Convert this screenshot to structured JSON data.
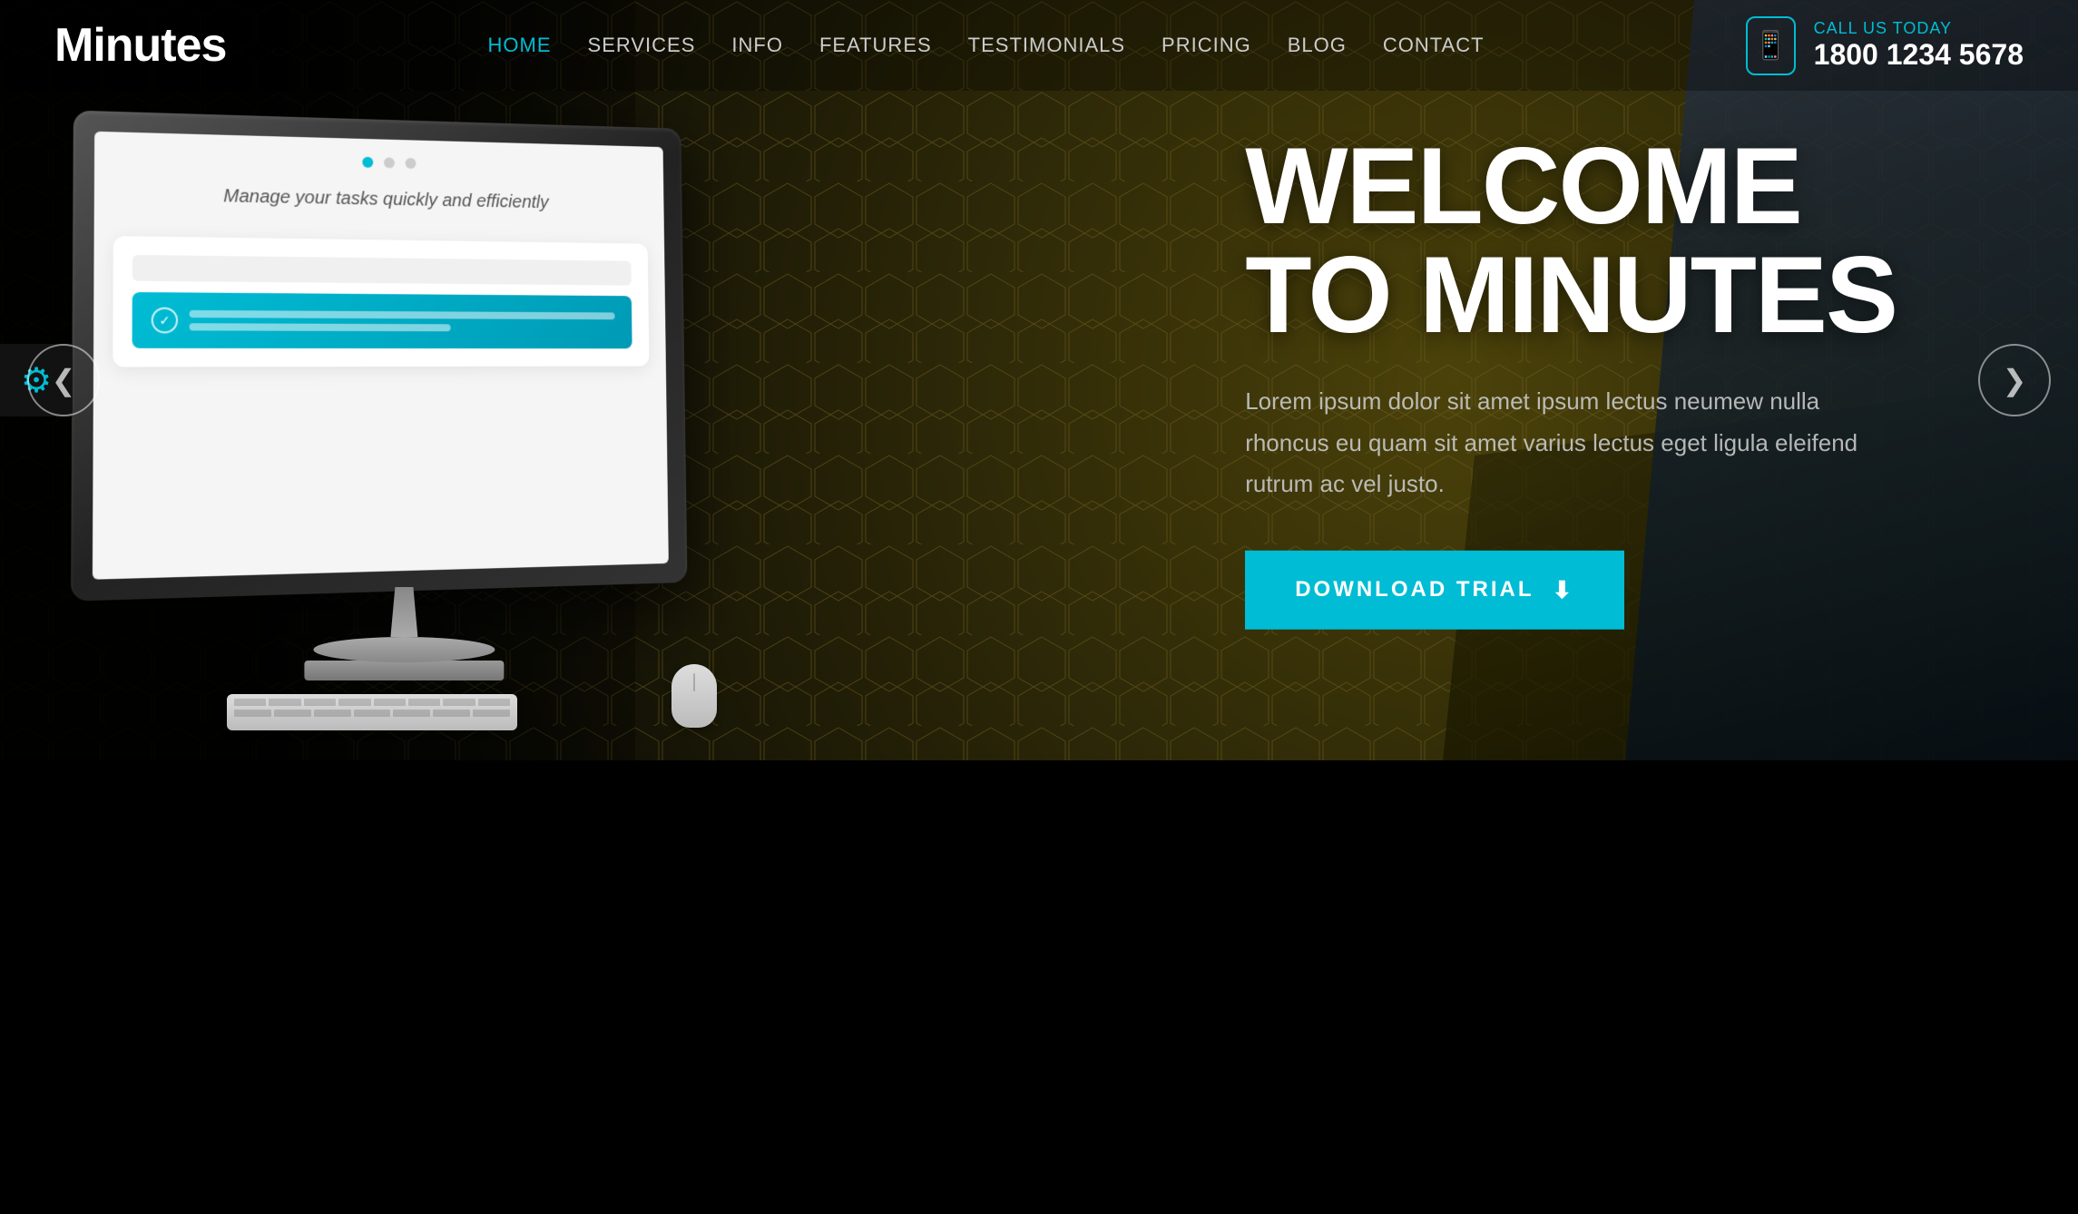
{
  "brand": {
    "name": "Minutes"
  },
  "nav": {
    "links": [
      {
        "id": "home",
        "label": "HOME",
        "active": true
      },
      {
        "id": "services",
        "label": "SERVICES",
        "active": false
      },
      {
        "id": "info",
        "label": "INFO",
        "active": false
      },
      {
        "id": "features",
        "label": "FEATURES",
        "active": false
      },
      {
        "id": "testimonials",
        "label": "TESTIMONIALS",
        "active": false
      },
      {
        "id": "pricing",
        "label": "PRICING",
        "active": false
      },
      {
        "id": "blog",
        "label": "BLOG",
        "active": false
      },
      {
        "id": "contact",
        "label": "CONTACT",
        "active": false
      }
    ]
  },
  "cta": {
    "call_label": "CALL US TODAY",
    "phone_number": "1800 1234 5678"
  },
  "hero": {
    "title_line1": "WELCOME",
    "title_line2": "TO MINUTES",
    "description": "Lorem ipsum dolor sit amet ipsum lectus neumew nulla rhoncus eu quam sit amet varius lectus eget ligula eleifend\nrutrum ac vel justo.",
    "button_label": "DOWNLOAD TRIAL"
  },
  "screen": {
    "text": "Manage your tasks quickly\nand efficiently"
  },
  "arrows": {
    "prev": "❮",
    "next": "❯"
  },
  "colors": {
    "accent": "#00bcd4",
    "bg_dark": "#111108",
    "text_light": "#ffffff"
  }
}
